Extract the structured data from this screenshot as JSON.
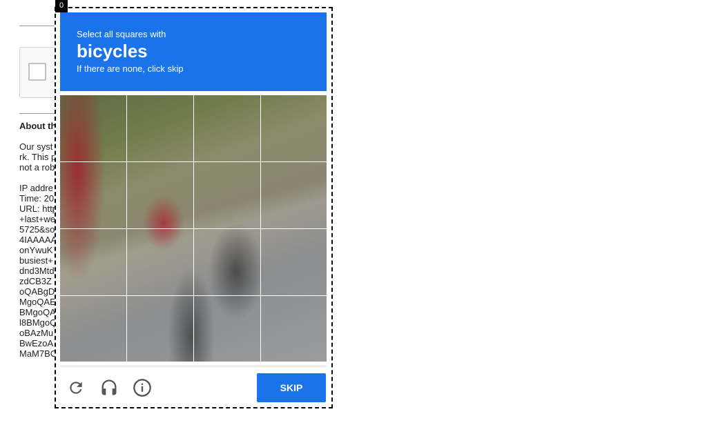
{
  "background_page": {
    "heading": "About th",
    "lines": [
      "Our syst",
      "rk. This p",
      "not a rob",
      "",
      "IP addre",
      "Time: 20",
      "URL: http",
      "+last+we",
      "5725&so",
      "4IAAAAA",
      "onYwuK",
      "busiest+",
      "dnd3Mtd",
      "zdCB3Z",
      "oQABgD",
      "MgoQAE",
      "BMgoQA",
      "l8BMgoQ",
      "oBAzMu",
      "BwEzoA",
      "MaM7BC"
    ]
  },
  "frame": {
    "tag": "0"
  },
  "challenge": {
    "instruction": "Select all squares with",
    "target": "bicycles",
    "hint": "If there are none, click skip"
  },
  "grid": {
    "rows": 4,
    "cols": 4,
    "selected": []
  },
  "toolbar": {
    "reload_icon": "reload-icon",
    "audio_icon": "headphones-icon",
    "info_icon": "info-icon",
    "skip_label": "SKIP"
  },
  "colors": {
    "accent": "#1a73e8",
    "icon": "#555555"
  }
}
